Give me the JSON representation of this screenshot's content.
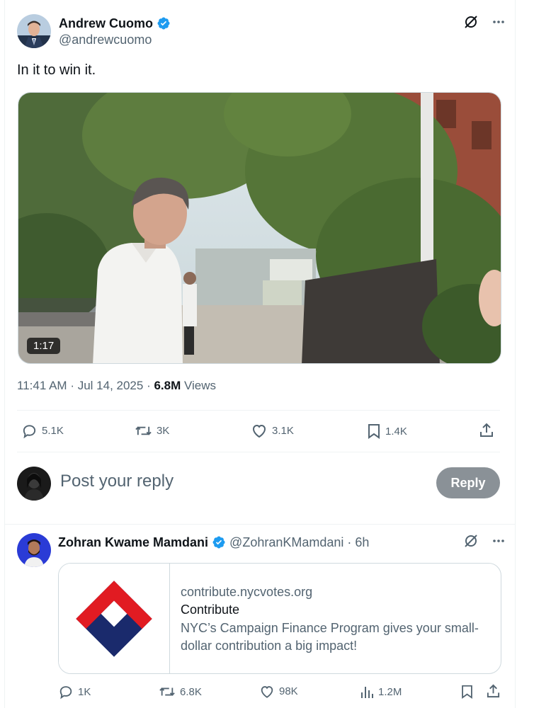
{
  "tweet": {
    "author_name": "Andrew Cuomo",
    "author_handle": "@andrewcuomo",
    "text": "In it to win it.",
    "video_duration": "1:17",
    "time": "11:41 AM",
    "date": "Jul 14, 2025",
    "views_count": "6.8M",
    "views_label": "Views",
    "stats": {
      "replies": "5.1K",
      "reposts": "3K",
      "likes": "3.1K",
      "bookmarks": "1.4K"
    }
  },
  "reply_box": {
    "placeholder": "Post your reply",
    "button_label": "Reply"
  },
  "reply": {
    "author_name": "Zohran Kwame Mamdani",
    "author_handle": "@ZohranKMamdani",
    "time_ago": "6h",
    "card": {
      "domain": "contribute.nycvotes.org",
      "title": "Contribute",
      "description": "NYC’s Campaign Finance Program gives your small-dollar contribution a big impact!"
    },
    "stats": {
      "replies": "1K",
      "reposts": "6.8K",
      "likes": "98K",
      "views": "1.2M"
    }
  },
  "colors": {
    "verified": "#1d9bf0",
    "muted_text": "#536471",
    "reply_button": "#8a9197"
  },
  "icons": [
    "grok-icon",
    "more-icon",
    "reply-icon",
    "repost-icon",
    "like-icon",
    "bookmark-icon",
    "share-icon",
    "views-icon",
    "verified-badge-icon"
  ]
}
